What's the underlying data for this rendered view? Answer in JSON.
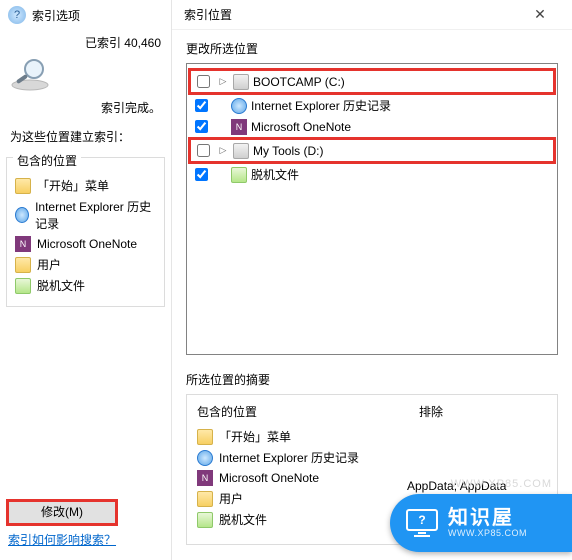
{
  "left": {
    "title": "索引选项",
    "status_count": "已索引 40,460",
    "status_done": "索引完成。",
    "build_label": "为这些位置建立索引：",
    "group_label": "包含的位置",
    "items": [
      {
        "label": "「开始」菜单"
      },
      {
        "label": "Internet Explorer 历史记录"
      },
      {
        "label": "Microsoft OneNote"
      },
      {
        "label": "用户"
      },
      {
        "label": "脱机文件"
      }
    ],
    "modify_btn": "修改(M)",
    "help_link": "索引如何影响搜索？"
  },
  "right": {
    "title": "索引位置",
    "change_label": "更改所选位置",
    "tree": [
      {
        "label": "BOOTCAMP (C:)",
        "checked": false,
        "highlight": true,
        "icon": "drive"
      },
      {
        "label": "Internet Explorer 历史记录",
        "checked": true,
        "highlight": false,
        "icon": "ie"
      },
      {
        "label": "Microsoft OneNote",
        "checked": true,
        "highlight": false,
        "icon": "one"
      },
      {
        "label": "My Tools (D:)",
        "checked": false,
        "highlight": true,
        "icon": "drive"
      },
      {
        "label": "脱机文件",
        "checked": true,
        "highlight": false,
        "icon": "offline"
      }
    ],
    "summary_label": "所选位置的摘要",
    "summary_included": "包含的位置",
    "summary_excluded": "排除",
    "summary_items": [
      {
        "label": "「开始」菜单"
      },
      {
        "label": "Internet Explorer 历史记录"
      },
      {
        "label": "Microsoft OneNote"
      },
      {
        "label": "用户"
      },
      {
        "label": "脱机文件"
      }
    ],
    "excluded_value": "AppData; AppData"
  },
  "brand": {
    "name": "知识屋",
    "url": "WWW.XP85.COM"
  }
}
